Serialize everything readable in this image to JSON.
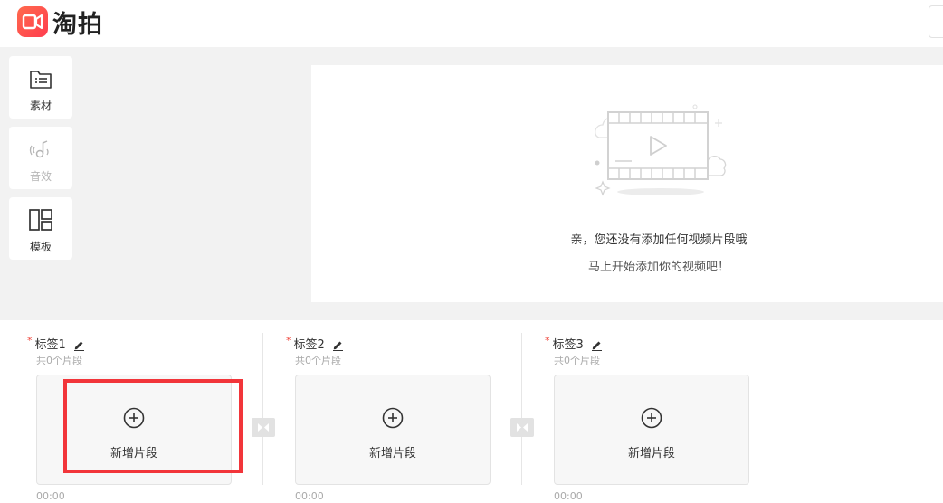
{
  "app": {
    "name": "淘拍",
    "brand_color": "#ff4d4f"
  },
  "toolbar": {
    "items": [
      {
        "label": "素材",
        "icon": "material-folder-icon",
        "enabled": true
      },
      {
        "label": "音效",
        "icon": "music-note-icon",
        "enabled": false
      },
      {
        "label": "模板",
        "icon": "template-layout-icon",
        "enabled": true
      }
    ]
  },
  "preview": {
    "empty_title": "亲，您还没有添加任何视频片段哦",
    "empty_subtitle": "马上开始添加你的视频吧！",
    "illustration": "film-strip-play-icon"
  },
  "clips": [
    {
      "label": "标签1",
      "required_mark": "*",
      "count_text": "共0个片段",
      "add_label": "新增片段",
      "duration": "00:00"
    },
    {
      "label": "标签2",
      "required_mark": "*",
      "count_text": "共0个片段",
      "add_label": "新增片段",
      "duration": "00:00"
    },
    {
      "label": "标签3",
      "required_mark": "*",
      "count_text": "共0个片段",
      "add_label": "新增片段",
      "duration": "00:00"
    }
  ],
  "highlight_color": "#f2353a"
}
